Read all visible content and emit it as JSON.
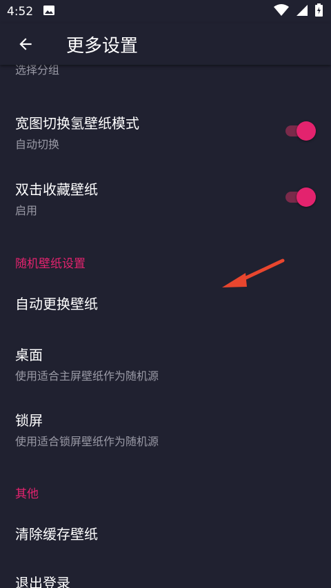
{
  "status_bar": {
    "time": "4:52"
  },
  "app_bar": {
    "title": "更多设置"
  },
  "items": [
    {
      "subtitle": "选择分组"
    },
    {
      "title": "宽图切换氢壁纸模式",
      "subtitle": "自动切换"
    },
    {
      "title": "双击收藏壁纸",
      "subtitle": "启用"
    }
  ],
  "section_random": {
    "header": "随机壁纸设置",
    "auto_change": "自动更换壁纸",
    "desktop_title": "桌面",
    "desktop_subtitle": "使用适合主屏壁纸作为随机源",
    "lock_title": "锁屏",
    "lock_subtitle": "使用适合锁屏壁纸作为随机源"
  },
  "section_other": {
    "header": "其他",
    "clear_cache": "清除缓存壁纸",
    "logout": "退出登录"
  },
  "colors": {
    "accent": "#e3236e",
    "background": "#202130",
    "annotation_arrow": "#e8462e"
  },
  "toggles": {
    "group": true,
    "wide_mode": true,
    "double_tap_fav": true
  }
}
